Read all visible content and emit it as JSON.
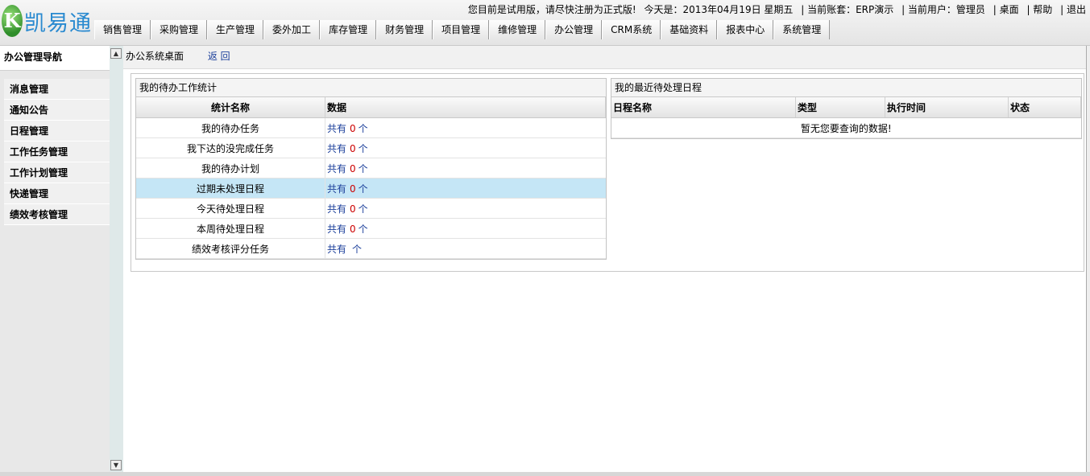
{
  "logo": {
    "letter": "K",
    "text": "凯易通"
  },
  "topbar": {
    "notice": "您目前是试用版，请尽快注册为正式版!",
    "today": "今天是：2013年04月19日  星期五",
    "account": "| 当前账套：ERP演示",
    "user": "| 当前用户：管理员",
    "desktop": "| 桌面",
    "help": "| 帮助",
    "logout": "| 退出"
  },
  "menu": [
    {
      "label": "销售管理"
    },
    {
      "label": "采购管理"
    },
    {
      "label": "生产管理"
    },
    {
      "label": "委外加工"
    },
    {
      "label": "库存管理"
    },
    {
      "label": "财务管理"
    },
    {
      "label": "项目管理"
    },
    {
      "label": "维修管理"
    },
    {
      "label": "办公管理"
    },
    {
      "label": "CRM系统"
    },
    {
      "label": "基础资料"
    },
    {
      "label": "报表中心"
    },
    {
      "label": "系统管理"
    }
  ],
  "sidebar": {
    "title": "办公管理导航",
    "items": [
      {
        "label": "消息管理"
      },
      {
        "label": "通知公告"
      },
      {
        "label": "日程管理"
      },
      {
        "label": "工作任务管理"
      },
      {
        "label": "工作计划管理"
      },
      {
        "label": "快递管理"
      },
      {
        "label": "绩效考核管理"
      }
    ]
  },
  "scroll": {
    "up_arrow": "▲",
    "down_arrow": "▼"
  },
  "breadcrumb": {
    "title": "办公系统桌面",
    "back": "返 回"
  },
  "todo_panel": {
    "title": "我的待办工作统计",
    "headers": {
      "name": "统计名称",
      "data": "数据"
    },
    "rows": [
      {
        "name": "我的待办任务",
        "prefix": "共有",
        "count": "0",
        "unit": "个"
      },
      {
        "name": "我下达的没完成任务",
        "prefix": "共有",
        "count": "0",
        "unit": "个"
      },
      {
        "name": "我的待办计划",
        "prefix": "共有",
        "count": "0",
        "unit": "个"
      },
      {
        "name": "过期未处理日程",
        "prefix": "共有",
        "count": "0",
        "unit": "个"
      },
      {
        "name": "今天待处理日程",
        "prefix": "共有",
        "count": "0",
        "unit": "个"
      },
      {
        "name": "本周待处理日程",
        "prefix": "共有",
        "count": "0",
        "unit": "个"
      },
      {
        "name": "绩效考核评分任务",
        "prefix": "共有",
        "count": "",
        "unit": "个"
      }
    ]
  },
  "schedule_panel": {
    "title": "我的最近待处理日程",
    "headers": {
      "name": "日程名称",
      "type": "类型",
      "time": "执行时间",
      "status": "状态"
    },
    "empty": "暂无您要查询的数据!"
  }
}
